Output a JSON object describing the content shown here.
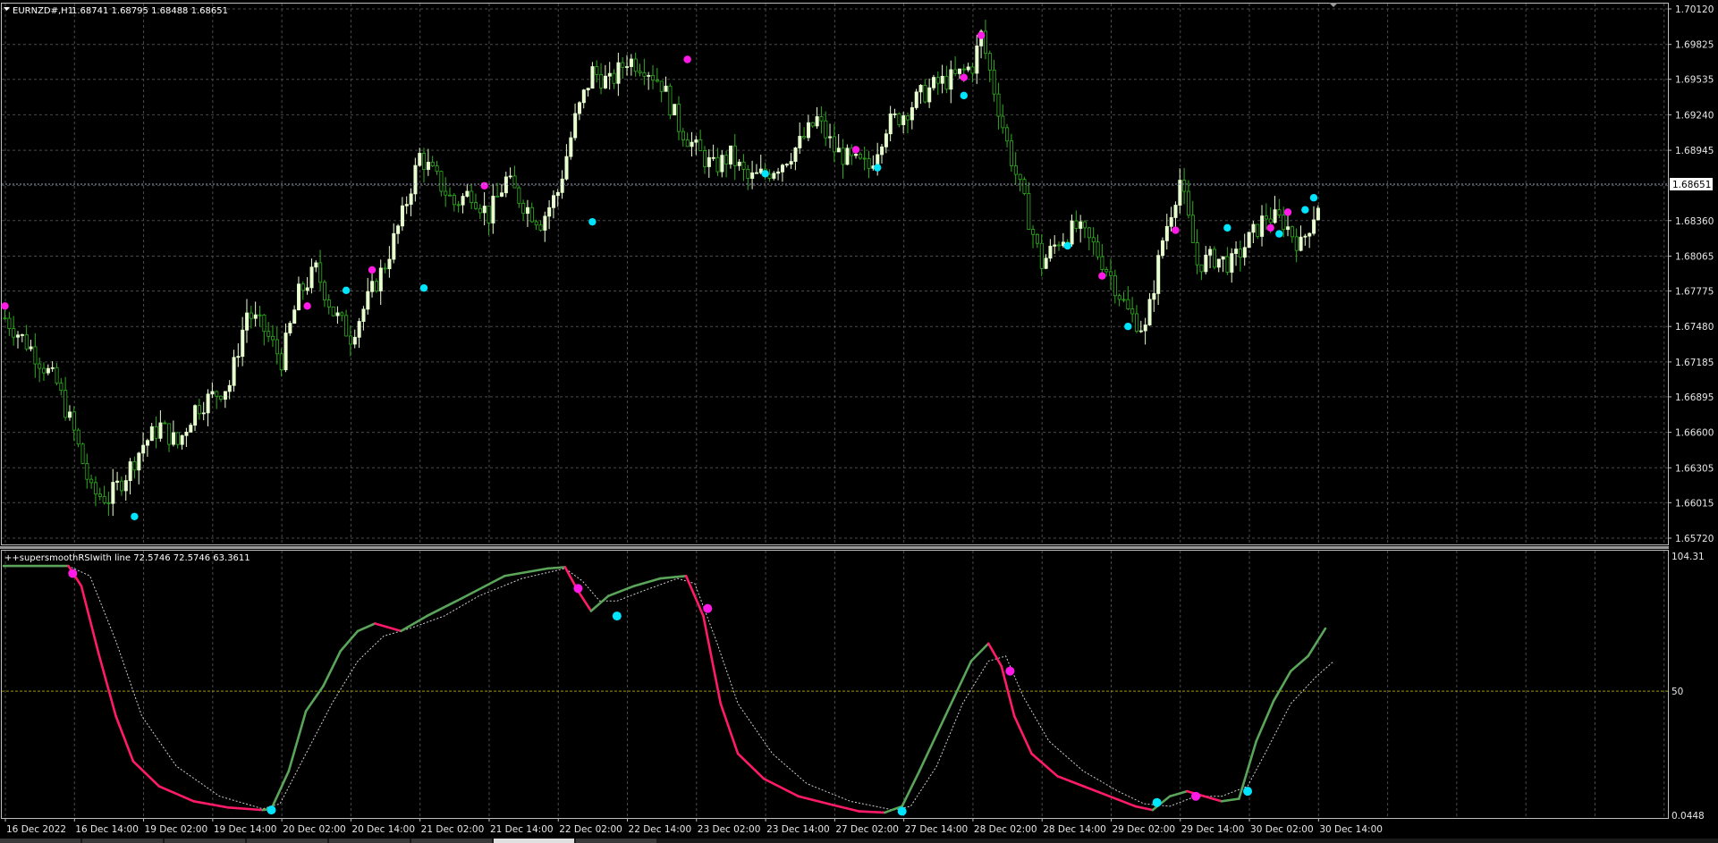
{
  "header": {
    "symbol": "EURNZD#,H1",
    "ohlc": "1.68741 1.68795 1.68488 1.68651"
  },
  "indicator": {
    "label": "++supersmoothRSIwith line 72.5746 72.5746 63.3611",
    "max_label": "104.31",
    "mid_label": "50",
    "min_label": "0.0448"
  },
  "colors": {
    "background": "#000000",
    "grid": "#4a4a4a",
    "bull_candle": "#e8ffd0",
    "bear_candle": "#2fae1f",
    "buy_dot": "#00e5ff",
    "sell_dot": "#ff1ae6",
    "rsi_up": "#5aa55a",
    "rsi_down": "#ff1a6a",
    "signal": "#cfcfcf",
    "level50": "#9a9a00"
  },
  "chart_data": [
    {
      "type": "candlestick",
      "symbol": "EURNZD#",
      "timeframe": "H1",
      "current_price": "1.68651",
      "y_ticks": [
        "1.70120",
        "1.69825",
        "1.69535",
        "1.69240",
        "1.68945",
        "1.68651",
        "1.68360",
        "1.68065",
        "1.67775",
        "1.67480",
        "1.67185",
        "1.66895",
        "1.66600",
        "1.66305",
        "1.66015",
        "1.65720"
      ],
      "ylim": [
        1.6572,
        1.7012
      ],
      "x_ticks": [
        "16 Dec 2022",
        "16 Dec 14:00",
        "19 Dec 02:00",
        "19 Dec 14:00",
        "20 Dec 02:00",
        "20 Dec 14:00",
        "21 Dec 02:00",
        "21 Dec 14:00",
        "22 Dec 02:00",
        "22 Dec 14:00",
        "23 Dec 02:00",
        "23 Dec 14:00",
        "27 Dec 02:00",
        "27 Dec 14:00",
        "28 Dec 02:00",
        "28 Dec 14:00",
        "29 Dec 02:00",
        "29 Dec 14:00",
        "30 Dec 02:00",
        "30 Dec 14:00"
      ],
      "close_path": [
        [
          0,
          1.6755
        ],
        [
          6,
          1.673
        ],
        [
          12,
          1.67
        ],
        [
          16,
          1.666
        ],
        [
          20,
          1.661
        ],
        [
          24,
          1.6605
        ],
        [
          28,
          1.6625
        ],
        [
          32,
          1.665
        ],
        [
          36,
          1.6665
        ],
        [
          40,
          1.665
        ],
        [
          44,
          1.668
        ],
        [
          48,
          1.669
        ],
        [
          52,
          1.67
        ],
        [
          56,
          1.676
        ],
        [
          60,
          1.6745
        ],
        [
          64,
          1.672
        ],
        [
          68,
          1.6775
        ],
        [
          72,
          1.6795
        ],
        [
          76,
          1.676
        ],
        [
          80,
          1.674
        ],
        [
          84,
          1.677
        ],
        [
          88,
          1.68
        ],
        [
          92,
          1.684
        ],
        [
          96,
          1.689
        ],
        [
          100,
          1.687
        ],
        [
          104,
          1.685
        ],
        [
          108,
          1.686
        ],
        [
          112,
          1.684
        ],
        [
          116,
          1.687
        ],
        [
          120,
          1.685
        ],
        [
          124,
          1.6835
        ],
        [
          128,
          1.686
        ],
        [
          132,
          1.692
        ],
        [
          136,
          1.696
        ],
        [
          140,
          1.695
        ],
        [
          144,
          1.697
        ],
        [
          148,
          1.6965
        ],
        [
          152,
          1.695
        ],
        [
          156,
          1.6915
        ],
        [
          160,
          1.6895
        ],
        [
          164,
          1.688
        ],
        [
          168,
          1.689
        ],
        [
          172,
          1.687
        ],
        [
          176,
          1.6875
        ],
        [
          180,
          1.6885
        ],
        [
          184,
          1.69
        ],
        [
          188,
          1.692
        ],
        [
          192,
          1.6895
        ],
        [
          196,
          1.6885
        ],
        [
          200,
          1.688
        ],
        [
          204,
          1.6915
        ],
        [
          208,
          1.6925
        ],
        [
          212,
          1.694
        ],
        [
          216,
          1.695
        ],
        [
          220,
          1.6955
        ],
        [
          224,
          1.6965
        ],
        [
          226,
          1.699
        ],
        [
          228,
          1.696
        ],
        [
          232,
          1.69
        ],
        [
          236,
          1.685
        ],
        [
          240,
          1.68
        ],
        [
          244,
          1.682
        ],
        [
          248,
          1.683
        ],
        [
          252,
          1.6815
        ],
        [
          256,
          1.679
        ],
        [
          260,
          1.676
        ],
        [
          264,
          1.6745
        ],
        [
          268,
          1.682
        ],
        [
          272,
          1.687
        ],
        [
          276,
          1.68
        ],
        [
          280,
          1.6805
        ],
        [
          284,
          1.68
        ],
        [
          288,
          1.682
        ],
        [
          292,
          1.684
        ],
        [
          296,
          1.6835
        ],
        [
          300,
          1.6815
        ],
        [
          304,
          1.685
        ]
      ],
      "buy_signals": [
        [
          30,
          1.659
        ],
        [
          79,
          1.6778
        ],
        [
          97,
          1.678
        ],
        [
          136,
          1.6835
        ],
        [
          176,
          1.6875
        ],
        [
          202,
          1.688
        ],
        [
          222,
          1.694
        ],
        [
          246,
          1.6815
        ],
        [
          260,
          1.6748
        ],
        [
          283,
          1.683
        ],
        [
          295,
          1.6825
        ],
        [
          301,
          1.6845
        ],
        [
          303,
          1.6855
        ]
      ],
      "sell_signals": [
        [
          0,
          1.6765
        ],
        [
          70,
          1.6765
        ],
        [
          85,
          1.6795
        ],
        [
          111,
          1.6865
        ],
        [
          158,
          1.697
        ],
        [
          197,
          1.6895
        ],
        [
          222,
          1.6955
        ],
        [
          226,
          1.699
        ],
        [
          254,
          1.679
        ],
        [
          271,
          1.6828
        ],
        [
          293,
          1.683
        ],
        [
          297,
          1.6843
        ]
      ]
    },
    {
      "type": "line",
      "name": "++supersmoothRSIwith line",
      "values_shown": [
        72.5746,
        72.5746,
        63.3611
      ],
      "ylim": [
        0.0448,
        104.31
      ],
      "levels": [
        50
      ],
      "rsi": [
        [
          0,
          100
        ],
        [
          15,
          100
        ],
        [
          18,
          92
        ],
        [
          22,
          65
        ],
        [
          26,
          40
        ],
        [
          30,
          22
        ],
        [
          36,
          12
        ],
        [
          44,
          6
        ],
        [
          52,
          3.5
        ],
        [
          60,
          2.5
        ],
        [
          62,
          3
        ],
        [
          66,
          18
        ],
        [
          70,
          42
        ],
        [
          74,
          52
        ],
        [
          78,
          66
        ],
        [
          82,
          74
        ],
        [
          86,
          77
        ],
        [
          92,
          74
        ],
        [
          98,
          80
        ],
        [
          106,
          87
        ],
        [
          116,
          96
        ],
        [
          126,
          99
        ],
        [
          130,
          99.5
        ],
        [
          133,
          90
        ],
        [
          136,
          82
        ],
        [
          140,
          88
        ],
        [
          146,
          92
        ],
        [
          152,
          95
        ],
        [
          158,
          96
        ],
        [
          162,
          80
        ],
        [
          166,
          45
        ],
        [
          170,
          25
        ],
        [
          176,
          15
        ],
        [
          184,
          8
        ],
        [
          192,
          4.5
        ],
        [
          198,
          2
        ],
        [
          204,
          1.5
        ],
        [
          208,
          4
        ],
        [
          212,
          18
        ],
        [
          218,
          40
        ],
        [
          224,
          62
        ],
        [
          228,
          69
        ],
        [
          231,
          60
        ],
        [
          234,
          40
        ],
        [
          238,
          25
        ],
        [
          244,
          16
        ],
        [
          250,
          12
        ],
        [
          256,
          8
        ],
        [
          262,
          4
        ],
        [
          266,
          2.5
        ],
        [
          270,
          8
        ],
        [
          274,
          10
        ],
        [
          278,
          8
        ],
        [
          282,
          6
        ],
        [
          286,
          7
        ],
        [
          290,
          30
        ],
        [
          294,
          46
        ],
        [
          298,
          58
        ],
        [
          302,
          64
        ],
        [
          306,
          75
        ]
      ],
      "signal": [
        [
          0,
          100
        ],
        [
          15,
          100
        ],
        [
          20,
          96
        ],
        [
          26,
          70
        ],
        [
          32,
          40
        ],
        [
          40,
          20
        ],
        [
          50,
          8
        ],
        [
          60,
          3
        ],
        [
          64,
          5
        ],
        [
          70,
          25
        ],
        [
          76,
          45
        ],
        [
          82,
          62
        ],
        [
          88,
          72
        ],
        [
          94,
          75
        ],
        [
          102,
          80
        ],
        [
          110,
          88
        ],
        [
          120,
          95
        ],
        [
          130,
          99
        ],
        [
          134,
          94
        ],
        [
          138,
          86
        ],
        [
          142,
          86
        ],
        [
          148,
          90
        ],
        [
          156,
          95
        ],
        [
          160,
          93
        ],
        [
          165,
          70
        ],
        [
          170,
          45
        ],
        [
          178,
          25
        ],
        [
          186,
          13
        ],
        [
          196,
          6
        ],
        [
          206,
          2.5
        ],
        [
          210,
          4
        ],
        [
          216,
          20
        ],
        [
          222,
          45
        ],
        [
          228,
          62
        ],
        [
          232,
          64
        ],
        [
          236,
          48
        ],
        [
          242,
          30
        ],
        [
          250,
          18
        ],
        [
          258,
          10
        ],
        [
          264,
          5
        ],
        [
          270,
          4
        ],
        [
          276,
          8
        ],
        [
          282,
          8
        ],
        [
          288,
          12
        ],
        [
          292,
          25
        ],
        [
          298,
          45
        ],
        [
          304,
          56
        ],
        [
          308,
          62
        ]
      ],
      "buy_signals": [
        [
          62,
          2.5
        ],
        [
          142,
          80
        ],
        [
          208,
          2
        ],
        [
          267,
          5.5
        ],
        [
          288,
          10
        ]
      ],
      "sell_signals": [
        [
          16,
          97
        ],
        [
          133,
          91
        ],
        [
          163,
          83
        ],
        [
          233,
          58
        ],
        [
          276,
          8
        ]
      ]
    }
  ]
}
